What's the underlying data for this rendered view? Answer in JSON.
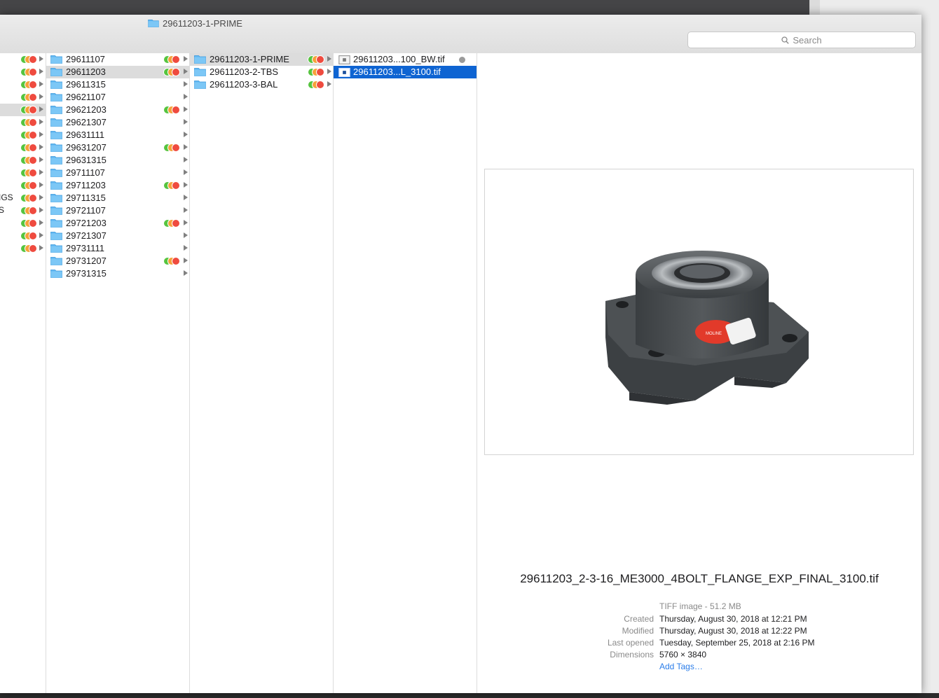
{
  "window": {
    "title": "29611203-1-PRIME",
    "search_placeholder": "Search"
  },
  "column1": {
    "partial_labels": [
      "IGS",
      "S"
    ]
  },
  "column2": {
    "items": [
      {
        "label": "29611107",
        "tags": true,
        "selected": false
      },
      {
        "label": "29611203",
        "tags": true,
        "selected": true
      },
      {
        "label": "29611315",
        "tags": false,
        "selected": false
      },
      {
        "label": "29621107",
        "tags": false,
        "selected": false
      },
      {
        "label": "29621203",
        "tags": true,
        "selected": false
      },
      {
        "label": "29621307",
        "tags": false,
        "selected": false
      },
      {
        "label": "29631111",
        "tags": false,
        "selected": false
      },
      {
        "label": "29631207",
        "tags": true,
        "selected": false
      },
      {
        "label": "29631315",
        "tags": false,
        "selected": false
      },
      {
        "label": "29711107",
        "tags": false,
        "selected": false
      },
      {
        "label": "29711203",
        "tags": true,
        "selected": false
      },
      {
        "label": "29711315",
        "tags": false,
        "selected": false
      },
      {
        "label": "29721107",
        "tags": false,
        "selected": false
      },
      {
        "label": "29721203",
        "tags": true,
        "selected": false
      },
      {
        "label": "29721307",
        "tags": false,
        "selected": false
      },
      {
        "label": "29731111",
        "tags": false,
        "selected": false
      },
      {
        "label": "29731207",
        "tags": true,
        "selected": false
      },
      {
        "label": "29731315",
        "tags": false,
        "selected": false
      }
    ]
  },
  "column3": {
    "items": [
      {
        "label": "29611203-1-PRIME",
        "selected": true
      },
      {
        "label": "29611203-2-TBS",
        "selected": false
      },
      {
        "label": "29611203-3-BAL",
        "selected": false
      }
    ]
  },
  "column4": {
    "items": [
      {
        "label": "29611203...100_BW.tif",
        "selected": false
      },
      {
        "label": "29611203...L_3100.tif",
        "selected": true
      }
    ]
  },
  "preview": {
    "filename": "29611203_2-3-16_ME3000_4BOLT_FLANGE_EXP_FINAL_3100.tif",
    "file_type": "TIFF image - 51.2 MB",
    "created_label": "Created",
    "created_value": "Thursday, August 30, 2018 at 12:21 PM",
    "modified_label": "Modified",
    "modified_value": "Thursday, August 30, 2018 at 12:22 PM",
    "last_opened_label": "Last opened",
    "last_opened_value": "Tuesday, September 25, 2018 at 2:16 PM",
    "dimensions_label": "Dimensions",
    "dimensions_value": "5760 × 3840",
    "add_tags": "Add Tags…",
    "product_logo_text": "MOLINE"
  },
  "colors": {
    "selection_blue": "#0e64d2",
    "selection_gray": "#dcdcdc",
    "folder_blue": "#5fb7f2",
    "tag_green": "#56c43f",
    "tag_orange": "#f6a13a",
    "tag_red": "#ef4b3f",
    "link_blue": "#2b7de9"
  }
}
